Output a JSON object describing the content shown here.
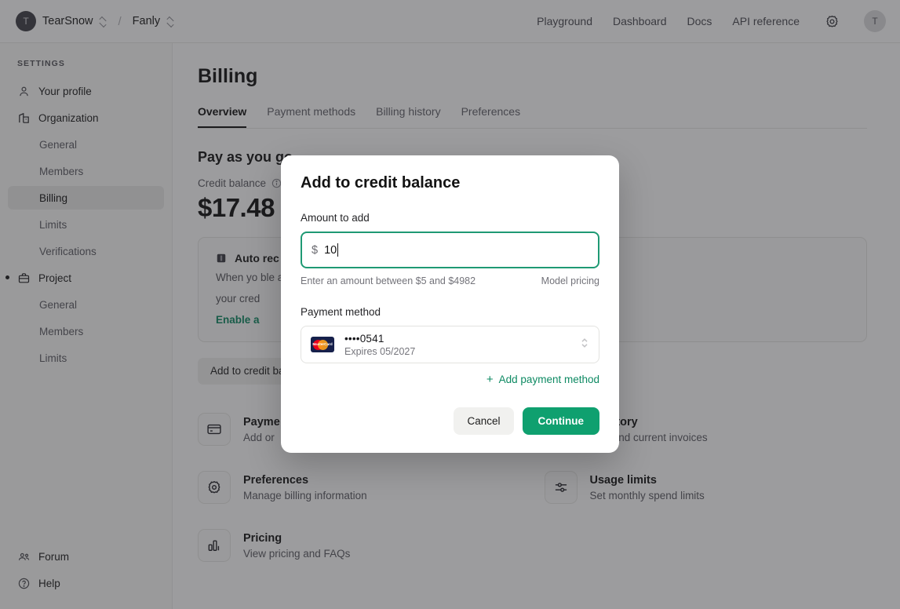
{
  "topnav": {
    "org_avatar_initial": "T",
    "org_name": "TearSnow",
    "separator": "/",
    "project_name": "Fanly",
    "links": [
      {
        "label": "Playground"
      },
      {
        "label": "Dashboard"
      },
      {
        "label": "Docs"
      },
      {
        "label": "API reference"
      }
    ],
    "settings_icon": "gear-icon",
    "user_avatar_initial": "T"
  },
  "sidebar": {
    "heading": "SETTINGS",
    "items": [
      {
        "label": "Your profile",
        "icon": "user-icon",
        "level": 1,
        "active": false
      },
      {
        "label": "Organization",
        "icon": "organization-icon",
        "level": 1,
        "active": false
      },
      {
        "label": "General",
        "icon": "",
        "level": 2,
        "active": false
      },
      {
        "label": "Members",
        "icon": "",
        "level": 2,
        "active": false
      },
      {
        "label": "Billing",
        "icon": "",
        "level": 2,
        "active": true
      },
      {
        "label": "Limits",
        "icon": "",
        "level": 2,
        "active": false
      },
      {
        "label": "Verifications",
        "icon": "",
        "level": 2,
        "active": false
      },
      {
        "label": "Project",
        "icon": "briefcase-icon",
        "level": 1,
        "active": false
      },
      {
        "label": "General",
        "icon": "",
        "level": 2,
        "active": false
      },
      {
        "label": "Members",
        "icon": "",
        "level": 2,
        "active": false
      },
      {
        "label": "Limits",
        "icon": "",
        "level": 2,
        "active": false
      }
    ],
    "bottom_items": [
      {
        "label": "Forum",
        "icon": "people-icon"
      },
      {
        "label": "Help",
        "icon": "question-circle-icon"
      }
    ]
  },
  "main": {
    "page_title": "Billing",
    "tabs": [
      {
        "label": "Overview",
        "active": true
      },
      {
        "label": "Payment methods",
        "active": false
      },
      {
        "label": "Billing history",
        "active": false
      },
      {
        "label": "Preferences",
        "active": false
      }
    ],
    "section_title": "Pay as you go",
    "credit_balance_label": "Credit balance",
    "credit_balance_amount": "$17.48",
    "auto_recharge": {
      "title": "Auto rec",
      "body": "When yo                                                                                                                      ble automatic recharge to automatically keep",
      "body_line2": "your cred",
      "link": "Enable a"
    },
    "add_credit_button": "Add to credit ba",
    "cards": [
      {
        "title": "Payme",
        "subtitle": "Add or",
        "icon": "credit-card-icon"
      },
      {
        "title": "g history",
        "subtitle": " past and current invoices",
        "icon": "receipt-icon"
      },
      {
        "title": "Preferences",
        "subtitle": "Manage billing information",
        "icon": "gear-icon"
      },
      {
        "title": "Usage limits",
        "subtitle": "Set monthly spend limits",
        "icon": "sliders-icon"
      },
      {
        "title": "Pricing",
        "subtitle": "View pricing and FAQs",
        "icon": "bar-chart-icon"
      }
    ]
  },
  "modal": {
    "title": "Add to credit balance",
    "amount_label": "Amount to add",
    "currency_symbol": "$",
    "amount_value": "10",
    "hint": "Enter an amount between $5 and $4982",
    "hint_link": "Model pricing",
    "payment_method_label": "Payment method",
    "payment_method": {
      "brand": "mastercard-logo",
      "brand_text": "MasterCard",
      "number": "••••0541",
      "expiry": "Expires 05/2027"
    },
    "add_payment_method": "Add payment method",
    "cancel_label": "Cancel",
    "continue_label": "Continue"
  },
  "colors": {
    "accent_green": "#0fa06f",
    "link_green": "#0e8a63",
    "focus_border": "#1f9a74",
    "overlay": "rgba(40,40,44,0.46)"
  }
}
